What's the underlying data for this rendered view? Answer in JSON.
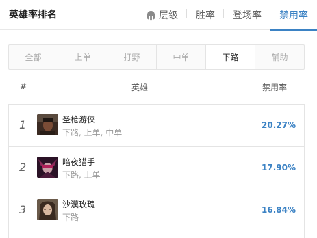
{
  "header": {
    "title": "英雄率排名",
    "tabs": [
      {
        "label": "层级",
        "icon": "helmet-icon"
      },
      {
        "label": "胜率"
      },
      {
        "label": "登场率"
      },
      {
        "label": "禁用率",
        "active": true
      }
    ]
  },
  "lanes": [
    "全部",
    "上单",
    "打野",
    "中单",
    "下路",
    "辅助"
  ],
  "active_lane": "下路",
  "table": {
    "col_rank": "#",
    "col_hero": "英雄",
    "col_ban": "禁用率",
    "rows": [
      {
        "rank": "1",
        "name": "圣枪游侠",
        "positions": "下路, 上单, 中单",
        "rate": "20.27%"
      },
      {
        "rank": "2",
        "name": "暗夜猎手",
        "positions": "下路, 上单",
        "rate": "17.90%"
      },
      {
        "rank": "3",
        "name": "沙漠玫瑰",
        "positions": "下路",
        "rate": "16.84%"
      }
    ]
  },
  "colors": {
    "accent": "#3b82c4"
  }
}
